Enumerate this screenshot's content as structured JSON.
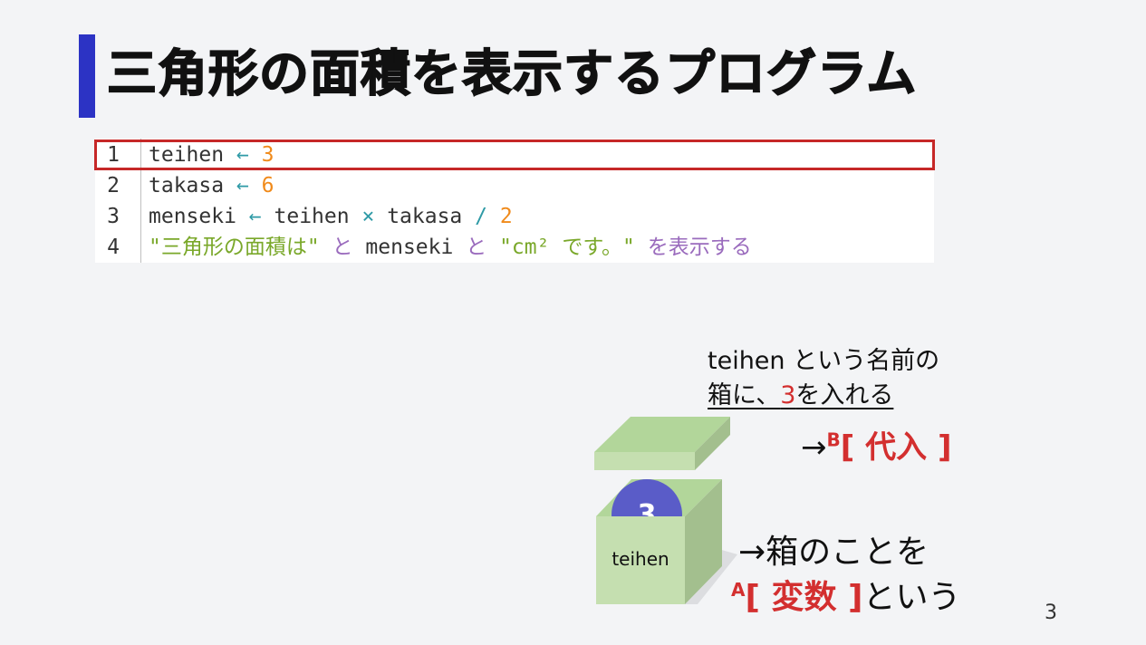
{
  "slide": {
    "title": "三角形の面積を表示するプログラム",
    "page_number": "3"
  },
  "code": {
    "lines": [
      {
        "num": "1",
        "id1": "teihen",
        "arrow": "←",
        "val": "3"
      },
      {
        "num": "2",
        "id1": "takasa",
        "arrow": "←",
        "val": "6"
      },
      {
        "num": "3",
        "id1": "menseki",
        "arrow": "←",
        "a": "teihen",
        "mul": "×",
        "b": "takasa",
        "div": "/",
        "c": "2"
      },
      {
        "num": "4",
        "s1": "\"三角形の面積は\"",
        "and1": "と",
        "v": "menseki",
        "and2": "と",
        "s2": "\"cm² です。\"",
        "tail": "を表示する"
      }
    ]
  },
  "annotation": {
    "line1": "teihen という名前の",
    "line2_pre": "箱に、",
    "line2_num": "3",
    "line2_post": "を入れる",
    "assign_arrow": "→",
    "assign_sup": "B",
    "assign_label": "[ 代入 ]",
    "var_line1": "→箱のことを",
    "var_sup": "A",
    "var_label": "[ 変数 ]",
    "var_suffix": "という"
  },
  "illustration": {
    "ball_value": "3",
    "box_label": "teihen",
    "colors": {
      "box_front": "#c5dfb0",
      "box_side": "#a3bf8e",
      "box_top": "#b2d69a",
      "ball": "#5a5cc8"
    }
  }
}
